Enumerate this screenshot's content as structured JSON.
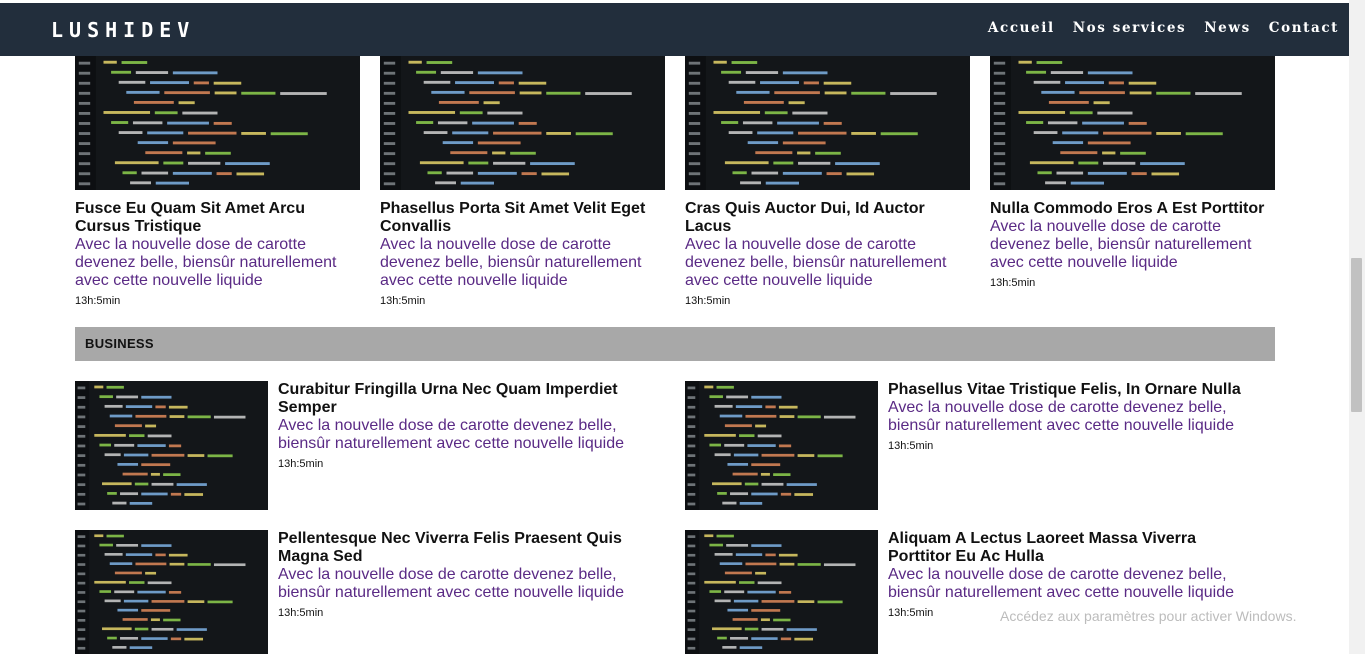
{
  "brand": "LUSHIDEV",
  "nav": [
    "Accueil",
    "Nos services",
    "News",
    "Contact"
  ],
  "cards": [
    {
      "title": "Fusce Eu Quam Sit Amet Arcu Cursus Tristique",
      "desc": "Avec la nouvelle dose de carotte devenez belle, biensûr naturellement avec cette nouvelle liquide",
      "time": "13h:5min"
    },
    {
      "title": "Phasellus Porta Sit Amet Velit Eget Convallis",
      "desc": "Avec la nouvelle dose de carotte devenez belle, biensûr naturellement avec cette nouvelle liquide",
      "time": "13h:5min"
    },
    {
      "title": "Cras Quis Auctor Dui, Id Auctor Lacus",
      "desc": "Avec la nouvelle dose de carotte devenez belle, biensûr naturellement avec cette nouvelle liquide",
      "time": "13h:5min"
    },
    {
      "title": "Nulla Commodo Eros A Est Porttitor",
      "desc": "Avec la nouvelle dose de carotte devenez belle, biensûr naturellement avec cette nouvelle liquide",
      "time": "13h:5min"
    }
  ],
  "section_title": "BUSINESS",
  "business": [
    {
      "title": "Curabitur Fringilla Urna Nec Quam Imperdiet Semper",
      "desc": "Avec la nouvelle dose de carotte devenez belle, biensûr naturellement avec cette nouvelle liquide",
      "time": "13h:5min"
    },
    {
      "title": "Phasellus Vitae Tristique Felis, In Ornare Nulla",
      "desc": "Avec la nouvelle dose de carotte devenez belle, biensûr naturellement avec cette nouvelle liquide",
      "time": "13h:5min"
    },
    {
      "title": "Pellentesque Nec Viverra Felis Praesent Quis Magna Sed",
      "desc": "Avec la nouvelle dose de carotte devenez belle, biensûr naturellement avec cette nouvelle liquide",
      "time": "13h:5min"
    },
    {
      "title": "Aliquam A Lectus Laoreet Massa Viverra Porttitor Eu Ac Hulla",
      "desc": "Avec la nouvelle dose de carotte devenez belle, biensûr naturellement avec cette nouvelle liquide",
      "time": "13h:5min"
    }
  ],
  "watermark": "Accédez aux paramètres pour activer Windows."
}
